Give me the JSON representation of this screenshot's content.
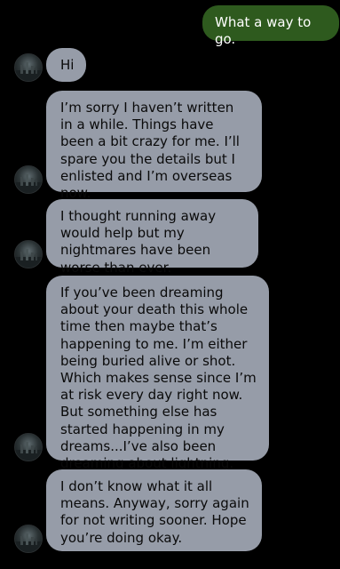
{
  "messages": [
    {
      "direction": "outgoing",
      "text": "What a way to go."
    },
    {
      "direction": "incoming",
      "text": "Hi"
    },
    {
      "direction": "incoming",
      "text": "I’m sorry I haven’t written in a while. Things have been a bit crazy for me. I’ll spare you the details but I enlisted and I’m overseas now."
    },
    {
      "direction": "incoming",
      "text": "I thought running away would help but my nightmares have been worse than ever."
    },
    {
      "direction": "incoming",
      "text": "If you’ve been dreaming about your death this whole time then maybe that’s happening to me. I’m either being buried alive or shot. Which makes sense since I’m at risk every day right now. But something else has started happening in my dreams...I’ve also been dreaming about lightning."
    },
    {
      "direction": "incoming",
      "text": "I don’t know what it all means. Anyway, sorry again for not writing sooner. Hope you’re doing okay."
    }
  ],
  "colors": {
    "background": "#000000",
    "outgoing_bubble": "#2e5a1e",
    "incoming_bubble": "#969ca8"
  },
  "icons": {
    "contact_avatar": "contact-avatar-icon"
  }
}
